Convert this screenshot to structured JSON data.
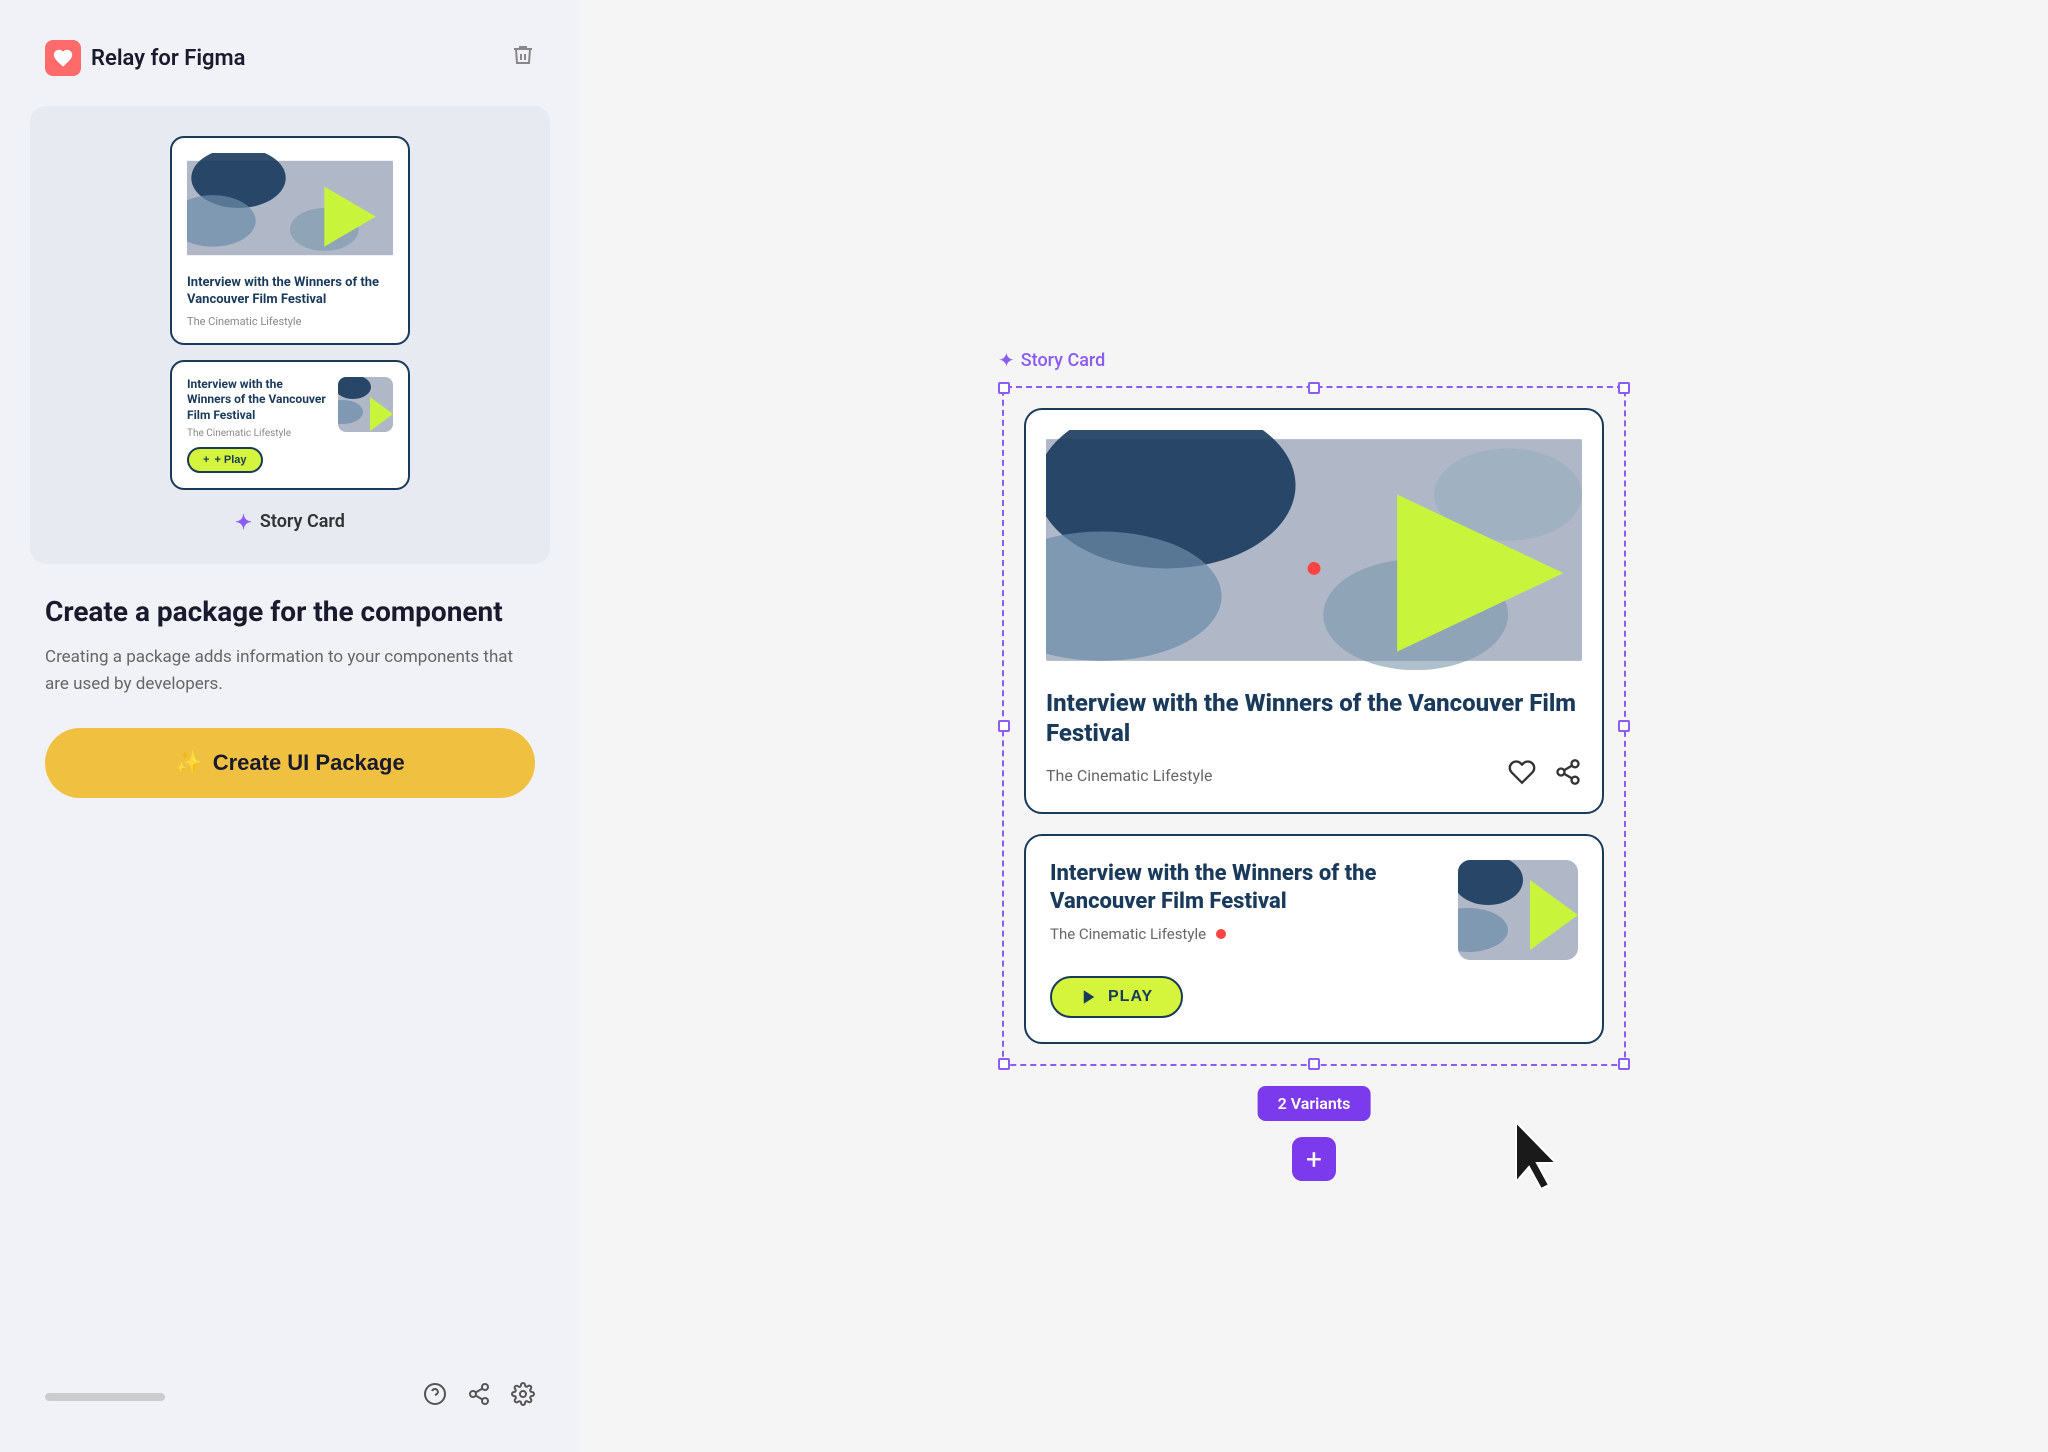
{
  "app": {
    "brand_name": "Relay for Figma",
    "brand_logo": "♥"
  },
  "left_panel": {
    "component_label": "Story Card",
    "content_title": "Create a package for the component",
    "content_desc": "Creating a package adds information to your components that are used by developers.",
    "create_btn_label": "Create UI Package",
    "create_btn_icon": "✨"
  },
  "card_small_vertical": {
    "title": "Interview with the Winners of the Vancouver Film Festival",
    "subtitle": "The Cinematic Lifestyle"
  },
  "card_small_horizontal": {
    "title": "Interview with the Winners of the Vancouver Film Festival",
    "subtitle": "The Cinematic Lifestyle",
    "play_label": "+ Play"
  },
  "selection": {
    "label": "Story Card"
  },
  "card_big_vertical": {
    "title": "Interview with the Winners of the Vancouver Film Festival",
    "subtitle": "The Cinematic Lifestyle"
  },
  "card_big_horizontal": {
    "title": "Interview with the Winners of the Vancouver Film Festival",
    "subtitle": "The Cinematic Lifestyle",
    "play_label": "PLAY"
  },
  "variants_badge": "2 Variants",
  "footer_icons": {
    "help": "?",
    "share": "↗",
    "settings": "⚙"
  }
}
